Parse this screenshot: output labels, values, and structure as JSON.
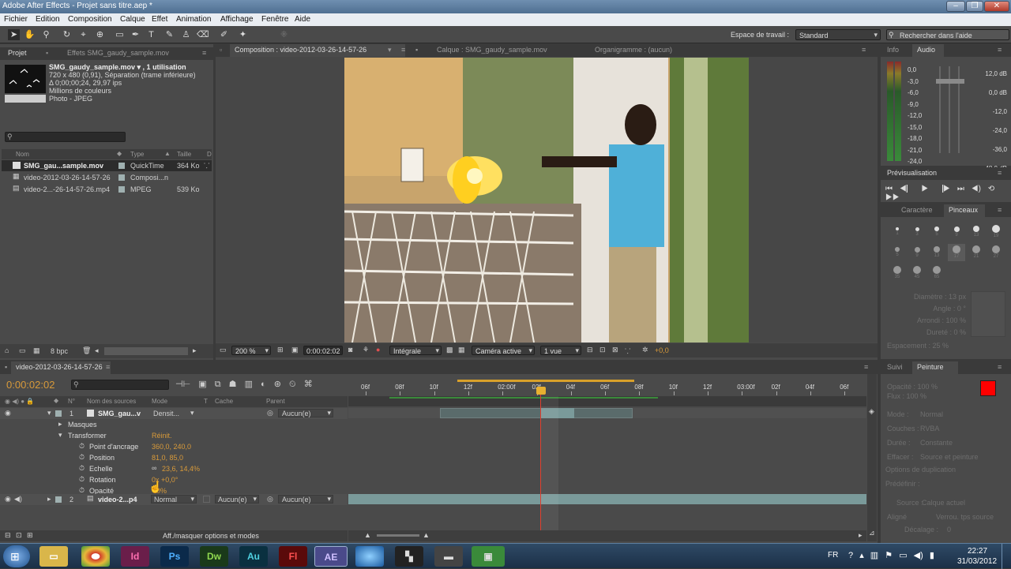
{
  "window": {
    "title": "Adobe After Effects - Projet sans titre.aep *"
  },
  "menu": [
    "Fichier",
    "Edition",
    "Composition",
    "Calque",
    "Effet",
    "Animation",
    "Affichage",
    "Fenêtre",
    "Aide"
  ],
  "workspace": {
    "label": "Espace de travail :",
    "value": "Standard",
    "search_placeholder": "Rechercher dans l'aide"
  },
  "project": {
    "tab": "Projet",
    "tab2": "Effets SMG_gaudy_sample.mov",
    "file_title": "SMG_gaudy_sample.mov ▾ , 1 utilisation",
    "info": [
      "720 x 480 (0,91), Séparation (trame inférieure)",
      "Δ 0;00;00;24, 29,97 ips",
      "Millions de couleurs",
      "Photo - JPEG"
    ],
    "columns": {
      "name": "Nom",
      "type": "Type",
      "size": "Taille",
      "d": "D"
    },
    "items": [
      {
        "name": "SMG_gau...sample.mov",
        "type": "QuickTime",
        "size": "364 Ko"
      },
      {
        "name": "video-2012-03-26-14-57-26",
        "type": "Composi...n",
        "size": ""
      },
      {
        "name": "video-2...-26-14-57-26.mp4",
        "type": "MPEG",
        "size": "539 Ko"
      }
    ],
    "bpc": "8 bpc"
  },
  "viewer": {
    "comp_tab": "Composition : video-2012-03-26-14-57-26",
    "layer_tab": "Calque : SMG_gaudy_sample.mov",
    "org_tab": "Organigramme : (aucun)",
    "zoom": "200 %",
    "time": "0:00:02:02",
    "quality": "Intégrale",
    "camera": "Caméra active",
    "views": "1 vue",
    "exposure": "+0,0"
  },
  "info_audio": {
    "tab_info": "Info",
    "tab_audio": "Audio",
    "left_scale": [
      "0,0",
      "-3,0",
      "-6,0",
      "-9,0",
      "-12,0",
      "-15,0",
      "-18,0",
      "-21,0",
      "-24,0"
    ],
    "right_scale": [
      "12,0 dB",
      "0,0 dB",
      "-12,0",
      "-24,0",
      "-36,0",
      "-48,0 dB"
    ]
  },
  "preview": {
    "tab": "Prévisualisation"
  },
  "brushes": {
    "tab_char": "Caractère",
    "tab_brush": "Pinceaux",
    "sizes": [
      "1",
      "3",
      "5",
      "9",
      "13",
      "19",
      "5",
      "9",
      "13",
      "17",
      "21",
      "27",
      "35",
      "45",
      "65"
    ],
    "params": [
      "Diamètre : 13 px",
      "Angle : 0 °",
      "Arrondi : 100 %",
      "Dureté : 0 %",
      "Espacement : 25 %"
    ]
  },
  "paint": {
    "tab_suivi": "Suivi",
    "tab_paint": "Peinture",
    "color": "#ff0000",
    "rows": [
      "Opacité : 100 %",
      "Flux : 100 %",
      "Mode :",
      "Couches :",
      "Durée :",
      "Effacer :",
      "Options de duplication",
      "Prédéfinir :",
      "Source :",
      "Aligné",
      "Verrou. tps source",
      "Décalage :"
    ],
    "values": {
      "mode": "Normal",
      "channels": "RVBA",
      "duration": "Constante",
      "erase": "Source et peinture",
      "source": "Calque actuel",
      "dec": "0"
    }
  },
  "timeline": {
    "tab": "video-2012-03-26-14-57-26",
    "current_time": "0:00:02:02",
    "columns": {
      "num": "N°",
      "source": "Nom des sources",
      "mode": "Mode",
      "t": "T",
      "cache": "Cache",
      "parent": "Parent"
    },
    "ruler": [
      "06f",
      "08f",
      "10f",
      "12f",
      "02:00f",
      "02f",
      "04f",
      "06f",
      "08f",
      "10f",
      "12f",
      "03:00f",
      "02f",
      "04f",
      "06f"
    ],
    "layers": [
      {
        "num": "1",
        "name": "SMG_gau...v",
        "mode": "Densit...",
        "parent": "Aucun(e)"
      },
      {
        "num": "2",
        "name": "video-2...p4",
        "mode": "Normal",
        "cache": "Aucun(e)",
        "parent": "Aucun(e)"
      }
    ],
    "props": {
      "masques": "Masques",
      "transformer": "Transformer",
      "reset": "Réinit.",
      "anchor": {
        "label": "Point d'ancrage",
        "value": "360,0, 240,0"
      },
      "position": {
        "label": "Position",
        "value": "81,0, 85,0"
      },
      "scale": {
        "label": "Echelle",
        "value": "23,6, 14,4%"
      },
      "rotation": {
        "label": "Rotation",
        "value": "0x +0,0°"
      },
      "opacity": {
        "label": "Opacité",
        "value": "0%"
      }
    },
    "toggle": "Aff./masquer options et modes"
  },
  "taskbar": {
    "lang": "FR",
    "time": "22:27",
    "date": "31/03/2012",
    "apps": [
      {
        "id": "explorer",
        "label": ""
      },
      {
        "id": "chrome",
        "label": ""
      },
      {
        "id": "indesign",
        "label": "Id"
      },
      {
        "id": "photoshop",
        "label": "Ps"
      },
      {
        "id": "dreamweaver",
        "label": "Dw"
      },
      {
        "id": "audition",
        "label": "Au"
      },
      {
        "id": "flash",
        "label": "Fl"
      },
      {
        "id": "aftereffects",
        "label": "AE"
      },
      {
        "id": "globe",
        "label": ""
      },
      {
        "id": "app9",
        "label": ""
      },
      {
        "id": "app10",
        "label": ""
      },
      {
        "id": "app11",
        "label": ""
      }
    ]
  }
}
